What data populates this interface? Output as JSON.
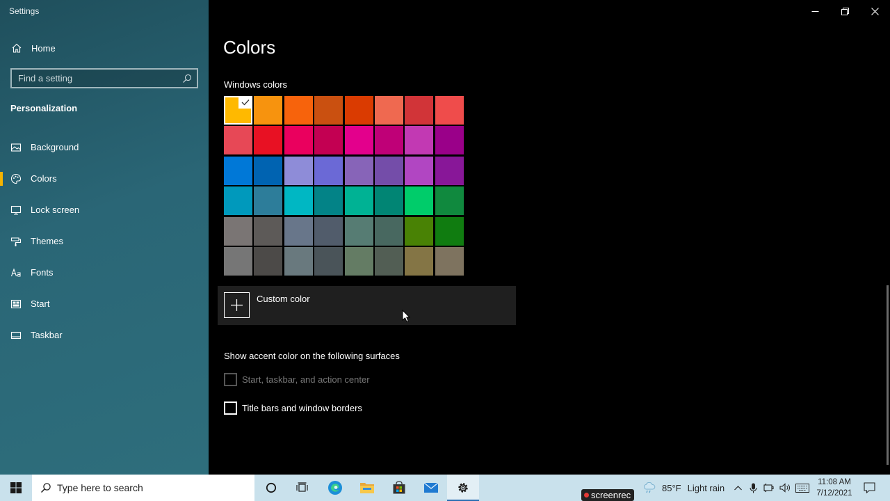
{
  "window": {
    "title": "Settings"
  },
  "sidebar": {
    "home_label": "Home",
    "search_placeholder": "Find a setting",
    "section_title": "Personalization",
    "items": [
      {
        "label": "Background",
        "icon": "picture-icon",
        "active": false
      },
      {
        "label": "Colors",
        "icon": "palette-icon",
        "active": true
      },
      {
        "label": "Lock screen",
        "icon": "lock-screen-icon",
        "active": false
      },
      {
        "label": "Themes",
        "icon": "brush-icon",
        "active": false
      },
      {
        "label": "Fonts",
        "icon": "font-icon",
        "active": false
      },
      {
        "label": "Start",
        "icon": "start-icon",
        "active": false
      },
      {
        "label": "Taskbar",
        "icon": "taskbar-icon",
        "active": false
      }
    ]
  },
  "main": {
    "title": "Colors",
    "windows_colors_label": "Windows colors",
    "selected_swatch_index": 0,
    "swatches": [
      "#FFB900",
      "#F7930E",
      "#F7630C",
      "#CA5010",
      "#DA3B01",
      "#EF6950",
      "#D13438",
      "#EF4C4B",
      "#E74856",
      "#E81123",
      "#EA005E",
      "#C30052",
      "#E3008C",
      "#BF0077",
      "#C239B3",
      "#9A0089",
      "#0078D7",
      "#0063B1",
      "#8E8CD8",
      "#6B69D6",
      "#8764B8",
      "#744DA9",
      "#B146C2",
      "#881798",
      "#0099BC",
      "#2D7D9A",
      "#00B7C3",
      "#038387",
      "#00B294",
      "#018574",
      "#00CC6A",
      "#10893E",
      "#7A7574",
      "#5D5A58",
      "#68768A",
      "#515C6B",
      "#567C73",
      "#486860",
      "#498205",
      "#107C10",
      "#767676",
      "#4C4A48",
      "#69797E",
      "#4A5459",
      "#647C64",
      "#525E54",
      "#847545",
      "#7E735F"
    ],
    "custom_color_label": "Custom color",
    "accent_surfaces_label": "Show accent color on the following surfaces",
    "checkboxes": [
      {
        "label": "Start, taskbar, and action center",
        "checked": false,
        "disabled": true
      },
      {
        "label": "Title bars and window borders",
        "checked": false,
        "disabled": false
      }
    ]
  },
  "taskbar": {
    "search_placeholder": "Type here to search",
    "apps": [
      "cortana-icon",
      "task-view-icon",
      "edge-icon",
      "file-explorer-icon",
      "store-icon",
      "mail-icon",
      "settings-icon"
    ],
    "active_app": "settings-icon",
    "recorder_label": "screenrec",
    "weather_temp": "85°F",
    "weather_condition": "Light rain",
    "time": "11:08 AM",
    "date": "7/12/2021"
  },
  "colors": {
    "sidebar": "#2a6676",
    "main_bg": "#000000",
    "accent_active": "#F5B400",
    "taskbar": "#C9E1EC"
  }
}
